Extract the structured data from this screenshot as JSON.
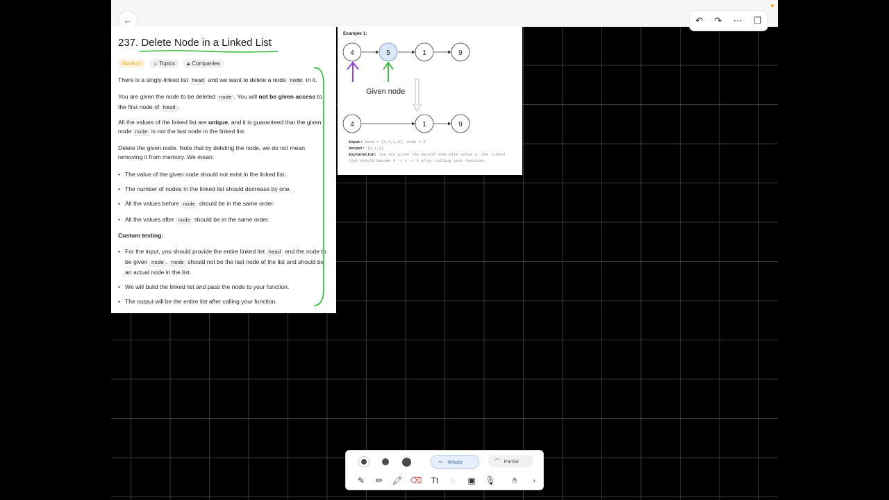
{
  "topbar": {
    "back_icon": "arrow-left-icon",
    "tools": [
      "undo-icon",
      "redo-icon",
      "more-icon",
      "pages-icon"
    ]
  },
  "problem": {
    "title": "237. Delete Node in a Linked List",
    "tags": {
      "difficulty": "Medium",
      "topics": "Topics",
      "companies": "Companies"
    },
    "p1": {
      "a": "There is a singly-linked list ",
      "code1": "head",
      "b": " and we want to delete a node ",
      "code2": "node",
      "c": " in it."
    },
    "p2": {
      "a": "You are given the node to be deleted ",
      "code1": "node",
      "b": ". You will ",
      "bold": "not be given access",
      "c": " to the first node of ",
      "code2": "head",
      "d": "."
    },
    "p3": {
      "a": "All the values of the linked list are ",
      "bold": "unique",
      "b": ", and it is guaranteed that the given node ",
      "code1": "node",
      "c": " is not the last node in the linked list."
    },
    "p4": "Delete the given node. Note that by deleting the node, we do not mean removing it from memory. We mean:",
    "bullets1": {
      "b1": "The value of the given node should not exist in the linked list.",
      "b2": "The number of nodes in the linked list should decrease by one.",
      "b3a": "All the values before ",
      "b3code": "node",
      "b3b": " should be in the same order.",
      "b4a": "All the values after ",
      "b4code": "node",
      "b4b": " should be in the same order."
    },
    "custom_heading": "Custom testing:",
    "bullets2": {
      "b1a": "For the input, you should provide the entire linked list ",
      "b1code1": "head",
      "b1b": " and the node to be given ",
      "b1code2": "node",
      "b1c": ". ",
      "b1code3": "node",
      "b1d": " should not be the last node of the list and should be an actual node in the list.",
      "b2": "We will build the linked list and pass the node to your function.",
      "b3": "The output will be the entire list after calling your function."
    }
  },
  "example": {
    "title": "Example 1:",
    "row1": [
      "4",
      "5",
      "1",
      "9"
    ],
    "row2": [
      "4",
      "1",
      "9"
    ],
    "given_label": "Given node",
    "input_label": "Input:",
    "input_value": " head = [4,5,1,9], node = 5",
    "output_label": "Output:",
    "output_value": " [4,1,9]",
    "explanation_label": "Explanation:",
    "explanation_value": " You are given the second node with value 5, the linked list should become 4 -> 1 -> 9 after calling your function.",
    "colors": {
      "highlight": "#dbe8f7",
      "purple": "#8a2be2",
      "green": "#2eb82e"
    }
  },
  "toolbar": {
    "sizes": [
      "small",
      "medium",
      "large"
    ],
    "whole_label": "Whole",
    "partial_label": "Partial",
    "tools": [
      "pen-icon",
      "pencil-icon",
      "highlighter-icon",
      "eraser-icon",
      "text-icon",
      "lasso-icon",
      "image-icon",
      "mic-icon",
      "hand-icon",
      "chevron-right-icon"
    ]
  },
  "colors": {
    "annotation_green": "#2eb82e",
    "accent": "#f5b324"
  }
}
